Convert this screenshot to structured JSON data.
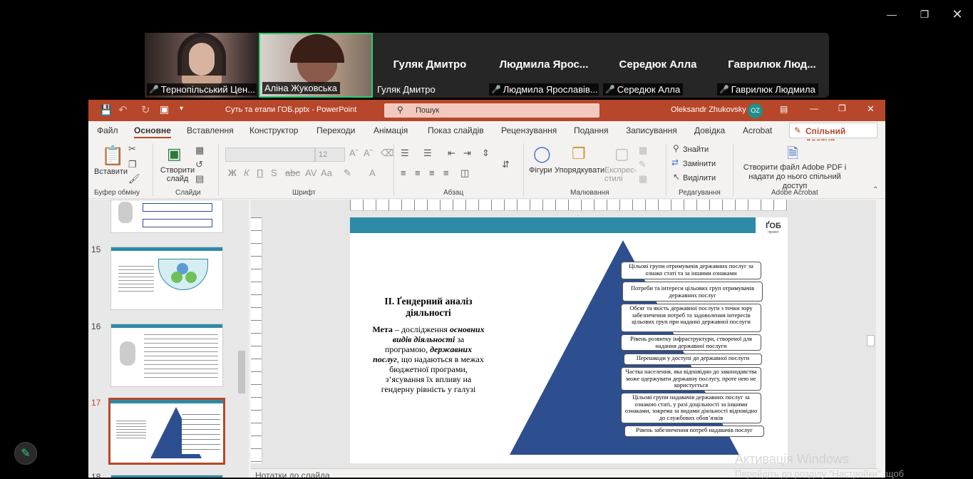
{
  "window": {
    "min_icon": "minimize-icon",
    "max_icon": "maximize-icon",
    "close_icon": "close-icon"
  },
  "participants": [
    {
      "label": "Тернопільський Цен...",
      "name": ""
    },
    {
      "label": "Аліна Жуковська",
      "name": ""
    },
    {
      "label": "Гуляк Дмитро",
      "name": "Гуляк Дмитро"
    },
    {
      "label": "Людмила Ярославів...",
      "name": "Людмила  Ярос..."
    },
    {
      "label": "Середюк Алла",
      "name": "Середюк Алла"
    },
    {
      "label": "Гаврилюк Людмила",
      "name": "Гаврилюк  Люд..."
    }
  ],
  "ppt": {
    "title": "Суть та етапи ГОБ.pptx  -  PowerPoint",
    "search": "Пошук",
    "user": "Oleksandr Zhukovsky",
    "initials": "OZ",
    "menu": [
      "Файл",
      "Основне",
      "Вставлення",
      "Конструктор",
      "Переходи",
      "Анімація",
      "Показ слайдів",
      "Рецензування",
      "Подання",
      "Записування",
      "Довідка",
      "Acrobat"
    ],
    "share": "Спільний доступ",
    "ribbon": {
      "paste": "Вставити",
      "clipboard": "Буфер обміну",
      "new_slide": "Створити слайд",
      "slides": "Слайди",
      "font_size": "12",
      "font": "Шрифт",
      "paragraph": "Абзац",
      "shapes": "Фігури",
      "arrange": "Упорядкувати",
      "quick_styles": "Експрес-стилі",
      "drawing": "Малювання",
      "find": "Знайти",
      "replace": "Замінити",
      "select": "Виділити",
      "editing": "Редагування",
      "acrobat_create": "Створити файл Adobe PDF і надати до нього спільний доступ",
      "acrobat": "Adobe Acrobat"
    },
    "slide_numbers": [
      "15",
      "16",
      "17",
      "18"
    ],
    "notes": "Нотатки до слайда"
  },
  "slide": {
    "logo": "ҐОБ",
    "logo_sub": "проект",
    "heading": "II. Ґендерний аналіз діяльності",
    "goal_label": "Мета",
    "goal_a": " – дослідження ",
    "goal_b": "основних видів діяльності",
    "goal_c": " за програмою, ",
    "goal_d": "державних послуг",
    "goal_e": ", що надаються в межах бюджетної програми, з’ясування їх впливу на гендерну рівність у галузі",
    "boxes": [
      "Цільові групи отримувачів державних послуг за ознако статі та за іншими ознаками",
      "Потреби та інтереси цільових груп отримувачів державних послуг",
      "Обсяг та якість державної послуги з точки зору забезпечення потреб та задоволення інтересів цільових груп при  наданні державної послуги",
      "Рівень розвитку інфраструктури, створеної для надання державної послуги",
      "Перешкоди у доступі до державної послуги",
      "Частка населення, яка відповідно до законодавства може одержувати державну послугу, проте нею не користується",
      "Цільові групи надавачів державних послуг за ознакою статі, у разі доцільності за іншими ознаками, зокрема за видами діяльності відповідно до службових обов’язків",
      "Рівень забезпечення потреб надавачів послуг"
    ]
  },
  "activation": {
    "title": "Активація Windows",
    "sub": "Перейдіть до розділу \"Настройки\", щоб"
  },
  "colors": {
    "ppt_red": "#b7472a",
    "teal": "#2e8ba6",
    "navy": "#2e4f8f",
    "teams_green": "#2ecc71"
  }
}
